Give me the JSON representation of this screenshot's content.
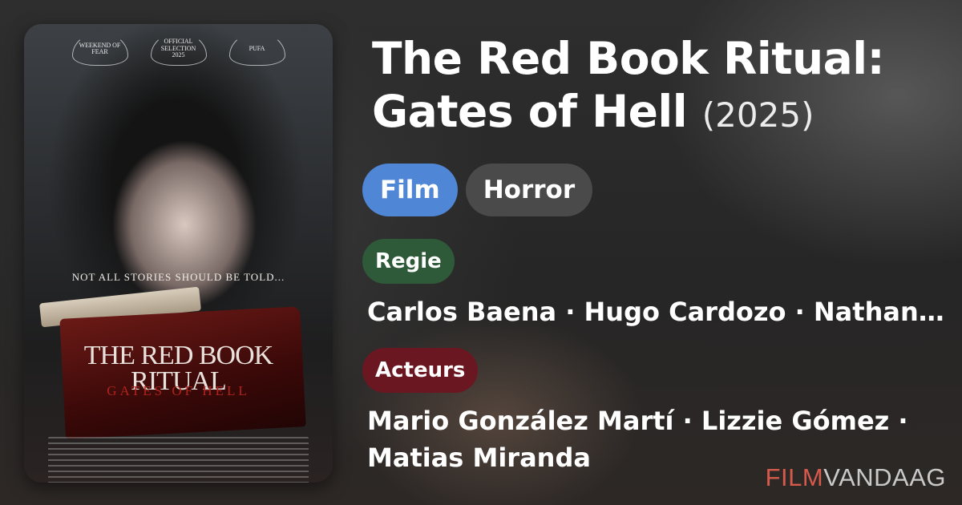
{
  "movie": {
    "title_line1": "The Red Book Ritual:",
    "title_line2": "Gates of Hell",
    "year": "(2025)"
  },
  "tags": {
    "type": "Film",
    "genre": "Horror"
  },
  "direction": {
    "label": "Regie",
    "names": "Carlos Baena · Hugo Cardozo · Nathan Cole"
  },
  "cast": {
    "label": "Acteurs",
    "names": "Mario González Martí · Lizzie Gómez · Matias Miranda"
  },
  "poster": {
    "laurel_1": "WEEKEND OF FEAR",
    "laurel_2": "OFFICIAL SELECTION 2025",
    "laurel_3": "PUFA",
    "tagline": "NOT ALL STORIES SHOULD BE TOLD...",
    "title_line1": "THE RED BOOK",
    "title_line2": "RITUAL",
    "subtitle": "GATES OF HELL"
  },
  "brand": {
    "part1": "FILM",
    "part2": "VANDAAG"
  },
  "colors": {
    "chip_film": "#4f86d6",
    "chip_genre": "#4a4a4a",
    "label_regie": "#2f5a3a",
    "label_acteurs": "#6b1722",
    "brand_accent": "#d55a4c"
  }
}
